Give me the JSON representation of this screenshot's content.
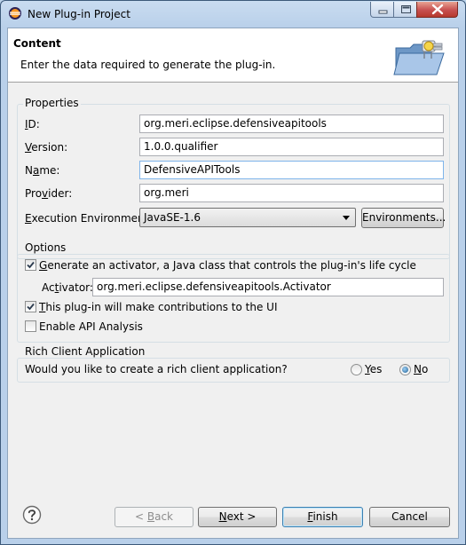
{
  "window": {
    "title": "New Plug-in Project"
  },
  "header": {
    "title": "Content",
    "description": "Enter the data required to generate the plug-in."
  },
  "properties": {
    "label": "Properties",
    "id": {
      "label_u": "I",
      "label_rest": "D:",
      "value": "org.meri.eclipse.defensiveapitools"
    },
    "version": {
      "label_u": "V",
      "label_rest": "ersion:",
      "value": "1.0.0.qualifier"
    },
    "name": {
      "label_pre": "N",
      "label_u": "a",
      "label_rest": "me:",
      "value": "DefensiveAPITools"
    },
    "provider": {
      "label_pre": "Pro",
      "label_u": "v",
      "label_rest": "ider:",
      "value": "org.meri"
    },
    "environment": {
      "label_u": "E",
      "label_rest": "xecution Environment:",
      "value": "JavaSE-1.6",
      "button_label": "Environments..."
    }
  },
  "options": {
    "label": "Options",
    "activator_checkbox": {
      "label_u": "G",
      "label_rest": "enerate an activator, a Java class that controls the plug-in's life cycle",
      "checked": true
    },
    "activator": {
      "label_pre": "Ac",
      "label_u": "t",
      "label_rest": "ivator:",
      "value": "org.meri.eclipse.defensiveapitools.Activator"
    },
    "ui_checkbox": {
      "label_u": "T",
      "label_rest": "his plug-in will make contributions to the UI",
      "checked": true
    },
    "api_checkbox": {
      "label": "Enable API Analysis",
      "checked": false
    }
  },
  "rcp": {
    "label": "Rich Client Application",
    "question": "Would you like to create a rich client application?",
    "yes": {
      "label_u": "Y",
      "label_rest": "es",
      "selected": false
    },
    "no": {
      "label_u": "N",
      "label_rest": "o",
      "selected": true
    }
  },
  "buttons": {
    "back_pre": "< ",
    "back_u": "B",
    "back_rest": "ack",
    "next_u": "N",
    "next_rest": "ext >",
    "finish_u": "F",
    "finish_rest": "inish",
    "cancel": "Cancel"
  },
  "colors": {
    "accent": "#3c7fb1",
    "title_bar": "#b9d0ea",
    "dialog_bg": "#f0f0f0"
  }
}
